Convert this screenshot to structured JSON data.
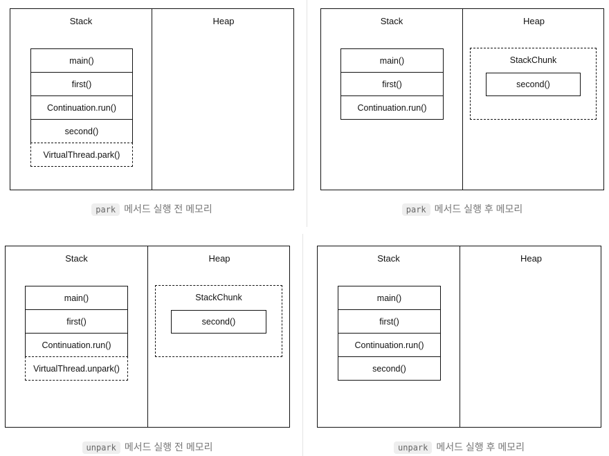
{
  "panels": [
    {
      "stack_title": "Stack",
      "heap_title": "Heap",
      "stack_frames": [
        "main()",
        "first()",
        "Continuation.run()",
        "second()",
        "VirtualThread.park()"
      ],
      "dashed_frame": "VirtualThread.park()",
      "heap_chunk": null,
      "caption_code": "park",
      "caption_text": "메서드 실행 전 메모리"
    },
    {
      "stack_title": "Stack",
      "heap_title": "Heap",
      "stack_frames": [
        "main()",
        "first()",
        "Continuation.run()"
      ],
      "dashed_frame": null,
      "heap_chunk": {
        "title": "StackChunk",
        "frames": [
          "second()"
        ]
      },
      "caption_code": "park",
      "caption_text": "메서드 실행 후 메모리"
    },
    {
      "stack_title": "Stack",
      "heap_title": "Heap",
      "stack_frames": [
        "main()",
        "first()",
        "Continuation.run()",
        "VirtualThread.unpark()"
      ],
      "dashed_frame": "VirtualThread.unpark()",
      "heap_chunk": {
        "title": "StackChunk",
        "frames": [
          "second()"
        ]
      },
      "caption_code": "unpark",
      "caption_text": "메서드 실행 전 메모리"
    },
    {
      "stack_title": "Stack",
      "heap_title": "Heap",
      "stack_frames": [
        "main()",
        "first()",
        "Continuation.run()",
        "second()"
      ],
      "dashed_frame": null,
      "heap_chunk": null,
      "caption_code": "unpark",
      "caption_text": "메서드 실행 후 메모리"
    }
  ]
}
